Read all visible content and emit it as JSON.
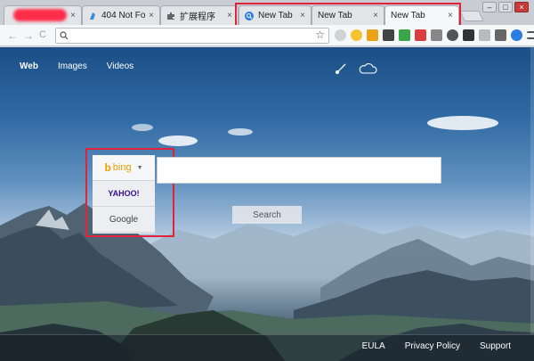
{
  "browser": {
    "tabs": [
      {
        "label": "",
        "favicon": "redacted-favicon"
      },
      {
        "label": "404 Not Fou",
        "favicon": "page-icon"
      },
      {
        "label": "扩展程序",
        "favicon": "puzzle-icon"
      },
      {
        "label": "New Tab",
        "favicon": "search-icon"
      },
      {
        "label": "New Tab",
        "favicon": "none"
      },
      {
        "label": "New Tab",
        "favicon": "none",
        "active": true
      }
    ],
    "close_glyph": "×",
    "window_buttons": [
      "–",
      "□",
      "×"
    ],
    "address": {
      "value": "",
      "star_glyph": "☆"
    },
    "nav": {
      "back": "←",
      "forward": "→",
      "reload": "C"
    }
  },
  "page": {
    "nav_links": [
      {
        "label": "Web",
        "selected": true
      },
      {
        "label": "Images"
      },
      {
        "label": "Videos"
      }
    ],
    "engines": {
      "bing": "bing",
      "yahoo": "YAHOO!",
      "google": "Google",
      "caret": "▼"
    },
    "search": {
      "placeholder": "",
      "button_label": "Search"
    },
    "footer": {
      "eula": "EULA",
      "privacy": "Privacy Policy",
      "support": "Support"
    }
  },
  "colors": {
    "highlight": "#e0233a",
    "bing": "#f0a000",
    "yahoo": "#3a0f8c"
  }
}
